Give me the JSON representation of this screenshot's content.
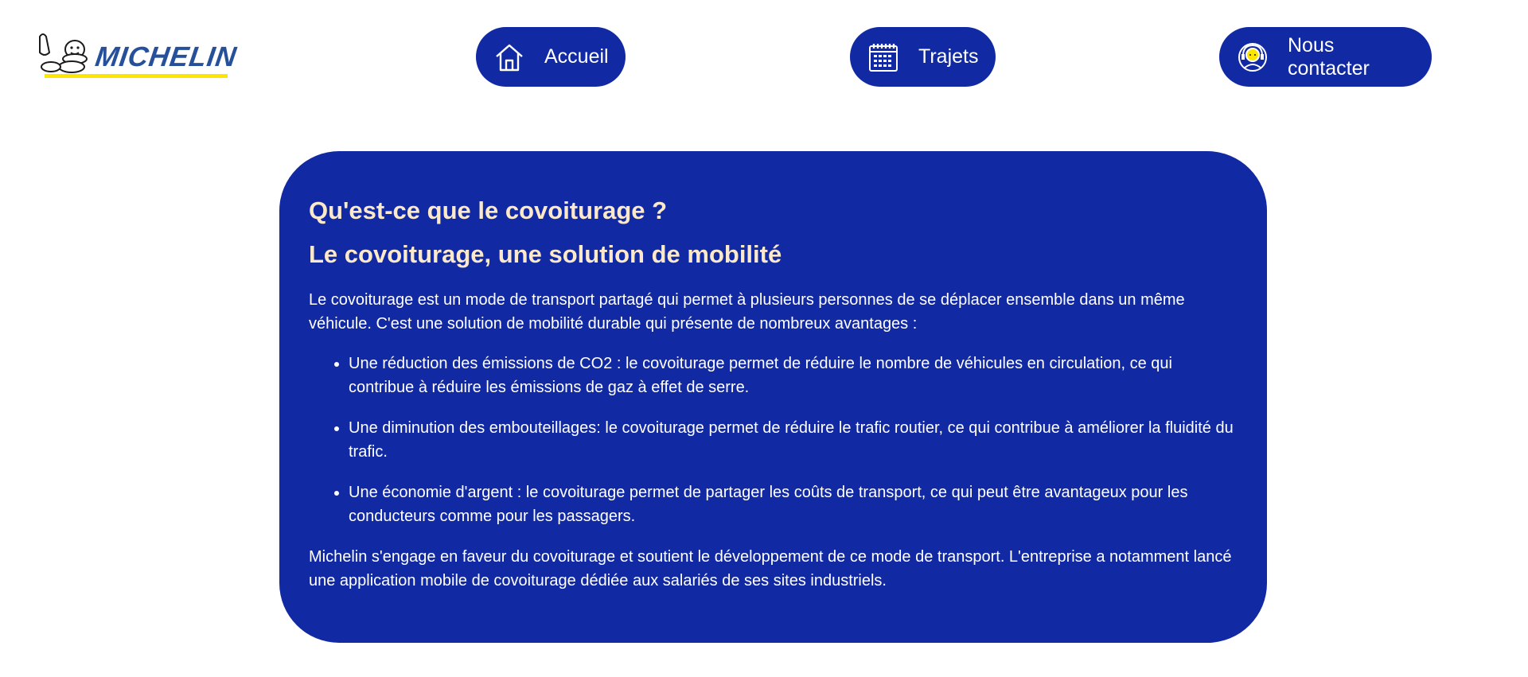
{
  "header": {
    "logo_text": "MICHELIN",
    "nav": [
      {
        "label": "Accueil",
        "icon": "home-icon"
      },
      {
        "label": "Trajets",
        "icon": "calendar-icon"
      },
      {
        "label": "Nous contacter",
        "icon": "contact-support-icon"
      }
    ]
  },
  "colors": {
    "brand_blue": "#1129a3",
    "heading": "#fbe9c9",
    "logo_yellow": "#fce500",
    "logo_blue": "#27509b"
  },
  "content": {
    "title": "Qu'est-ce que le covoiturage ?",
    "subtitle": "Le covoiturage, une solution de mobilité",
    "intro": "Le covoiturage est un mode de transport partagé qui permet à plusieurs personnes de se déplacer ensemble dans un même véhicule. C'est une solution de mobilité durable qui présente de nombreux avantages :",
    "bullets": [
      "Une réduction des émissions de CO2 : le covoiturage permet de réduire le nombre de véhicules en circulation, ce qui contribue à réduire les émissions de gaz à effet de serre.",
      "Une diminution des embouteillages: le covoiturage permet de réduire le trafic routier, ce qui contribue à améliorer la fluidité du trafic.",
      "Une économie d'argent : le covoiturage permet de partager les coûts de transport, ce qui peut être avantageux pour les conducteurs comme pour les passagers."
    ],
    "outro": "Michelin s'engage en faveur du covoiturage et soutient le développement de ce mode de transport. L'entreprise a notamment lancé une application mobile de covoiturage dédiée aux salariés de ses sites industriels."
  }
}
